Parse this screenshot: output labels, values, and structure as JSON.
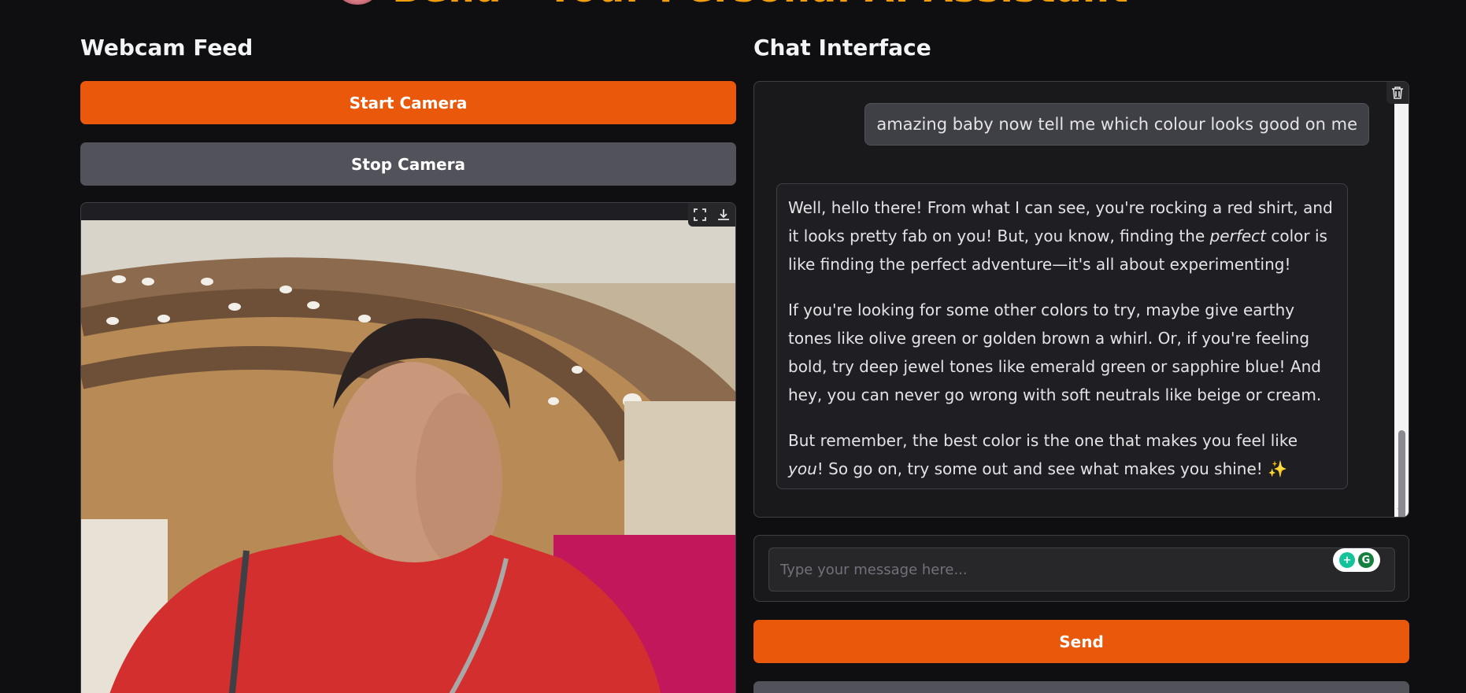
{
  "app": {
    "title": "Bella - Your Personal AI Assistant"
  },
  "webcam": {
    "heading": "Webcam Feed",
    "start_label": "Start Camera",
    "stop_label": "Stop Camera",
    "fullscreen_icon": "fullscreen-icon",
    "download_icon": "download-icon"
  },
  "chat": {
    "heading": "Chat Interface",
    "clear_icon": "trash-icon",
    "user_message": "amazing baby now tell me which colour looks good on me",
    "bot_message": {
      "p1_a": "Well, hello there! From what I can see, you're rocking a red shirt, and it looks pretty fab on you! But, you know, finding the ",
      "p1_em": "perfect",
      "p1_b": " color is like finding the perfect adventure—it's all about experimenting!",
      "p2": "If you're looking for some other colors to try, maybe give earthy tones like olive green or golden brown a whirl. Or, if you're feeling bold, try deep jewel tones like emerald green or sapphire blue! And hey, you can never go wrong with soft neutrals like beige or cream.",
      "p3_a": "But remember, the best color is the one that makes you feel like ",
      "p3_em": "you",
      "p3_b": "! So go on, try some out and see what makes you shine! ✨"
    },
    "input_placeholder": "Type your message here...",
    "send_label": "Send"
  },
  "colors": {
    "background": "#0f0f11",
    "primary": "#ea580c",
    "secondary": "#52525b",
    "title": "#f59e0b"
  }
}
